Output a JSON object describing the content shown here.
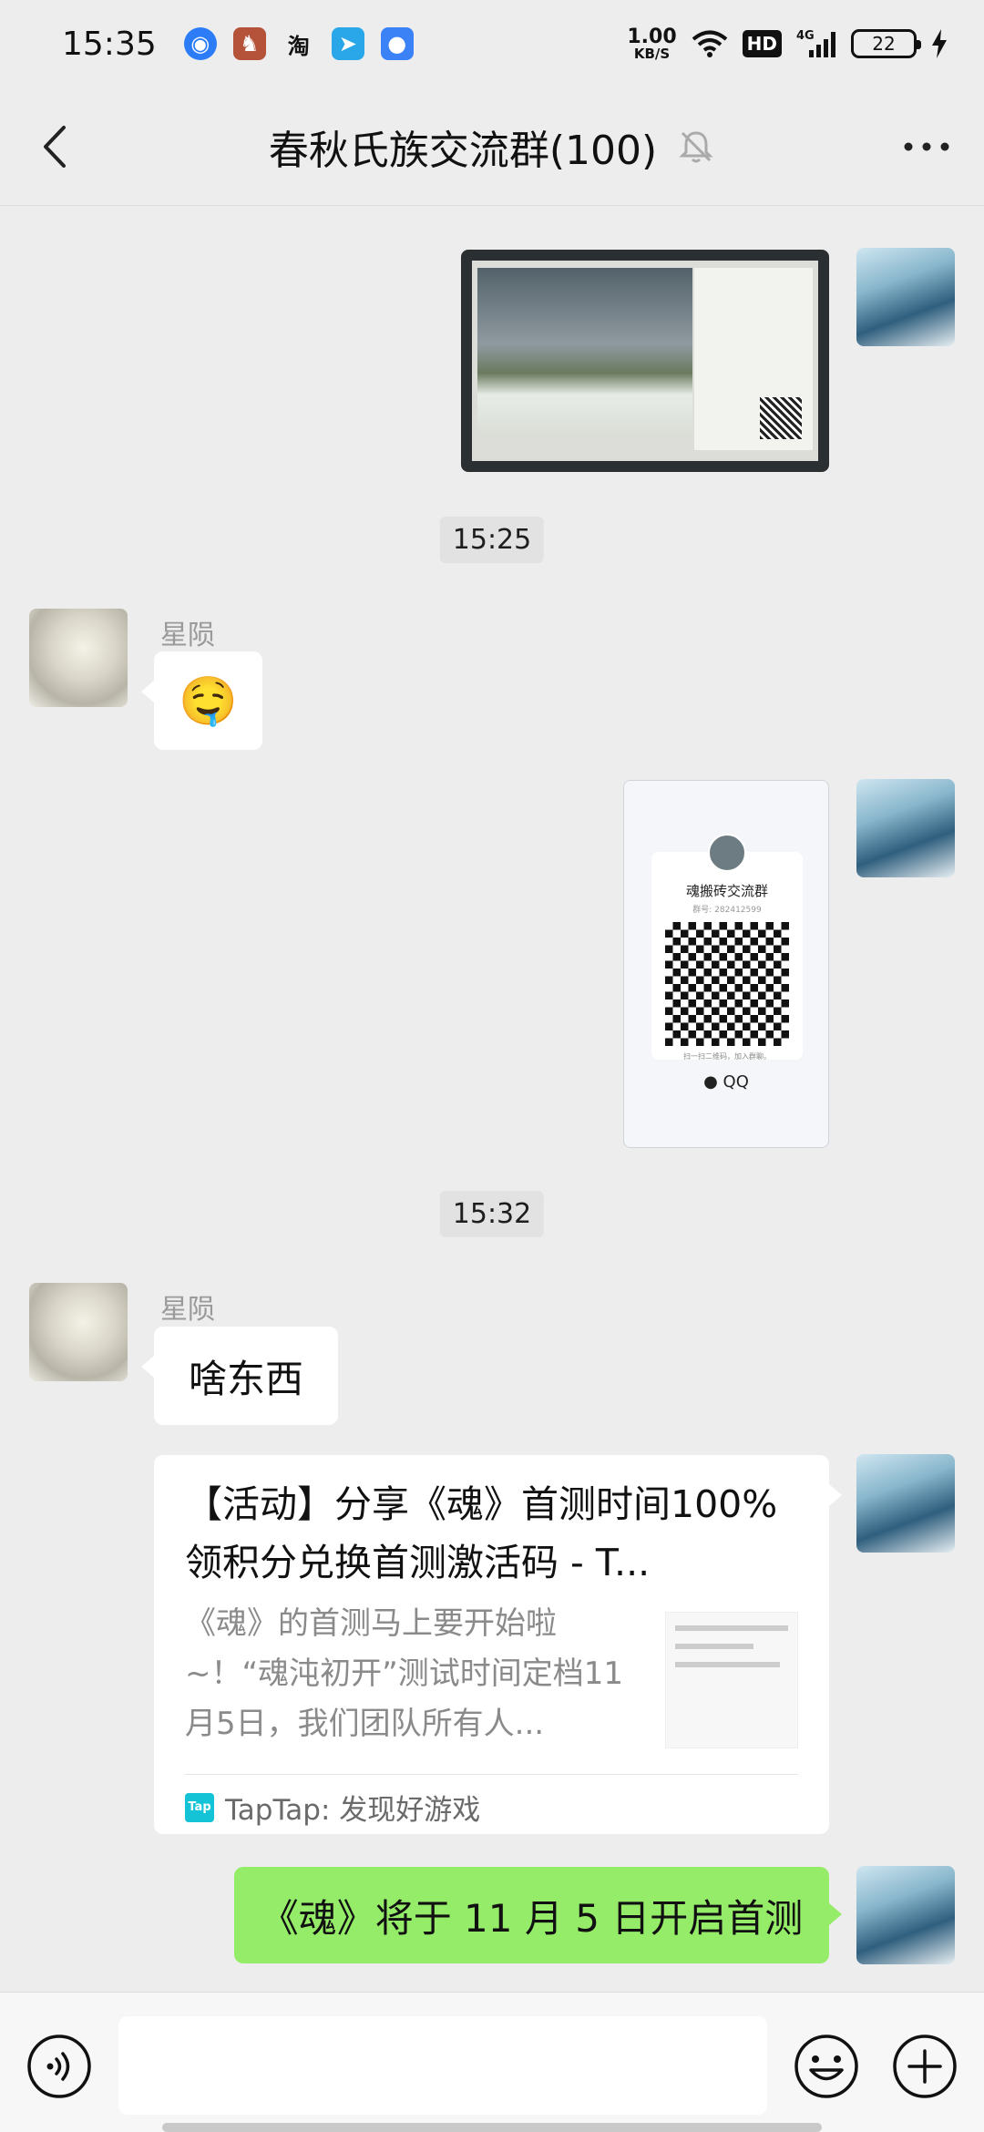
{
  "status_bar": {
    "time": "15:35",
    "net_speed_value": "1.00",
    "net_speed_unit": "KB/S",
    "hd": "HD",
    "network": "4G",
    "battery": "22",
    "notif_taobao": "淘"
  },
  "header": {
    "title": "春秋氏族交流群(100)"
  },
  "timestamps": [
    "15:25",
    "15:32"
  ],
  "sender": "星陨",
  "messages": {
    "emoji_msg": "🤤",
    "text_msg": "啥东西",
    "qr_card": {
      "group_name": "魂搬砖交流群",
      "group_no": "群号: 282412599",
      "hint": "扫一扫二维码，加入群聊。",
      "brand": "QQ"
    },
    "link_card": {
      "title": "【活动】分享《魂》首测时间100%领积分兑换首测激活码 - T...",
      "desc": "《魂》的首测马上要开始啦~！“魂沌初开”测试时间定档11月5日，我们团队所有人...",
      "source_icon": "Tap",
      "source": "TapTap: 发现好游戏"
    },
    "my_text": "《魂》将于 11 月 5 日开启首测"
  },
  "input": {
    "placeholder": ""
  },
  "colors": {
    "bg": "#ededed",
    "green_bubble": "#95ec69",
    "white_bubble": "#ffffff",
    "tap_brand": "#14c4d6"
  }
}
